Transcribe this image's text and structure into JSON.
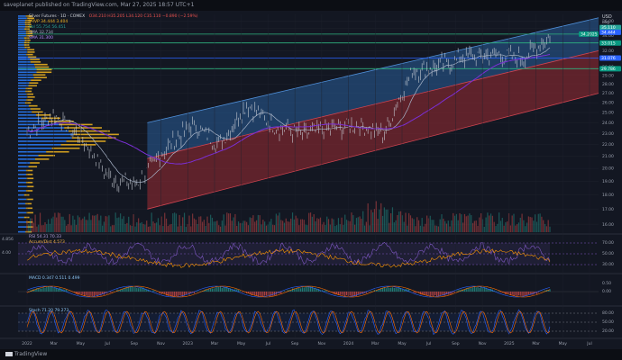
{
  "header": {
    "publish_note": "saveplanet published on TradingView.com, Mar 27, 2025 18:57 UTC+1"
  },
  "legend": {
    "symbol": "Silver Futures · 1D · COMEX",
    "ohlc": "O34.210 H35.205 L34.120 C35.110 −0.890 (−2.59%)",
    "vrvp": "VRVP 34.444  3.404",
    "vol": "Vol 55.754  56.451",
    "sma1": "SMA 32.734",
    "sma2": "SMA 31.300"
  },
  "panes": {
    "rsi_label": "RSI 54.31  70.33",
    "accdist_label": "Accum/Dist 4.573",
    "macd_label": "MACD 0.347 0.511 0.499",
    "stoch_label": "Stoch 71.20 79.273"
  },
  "price_axis": {
    "unit": "USD",
    "mode": "Log",
    "ticks": [
      "36.00",
      "35.00",
      "34.00",
      "33.00",
      "32.00",
      "31.00",
      "30.00",
      "29.00",
      "28.00",
      "27.00",
      "26.00",
      "25.00",
      "24.00",
      "23.00",
      "22.00",
      "21.00",
      "20.00",
      "19.00",
      "18.00",
      "17.00",
      "16.00"
    ],
    "badges": [
      {
        "text": "35.110",
        "color": "#26a69a"
      },
      {
        "text": "34.444",
        "color": "#2962ff"
      },
      {
        "text": "33.015",
        "color": "#089981"
      },
      {
        "text": "31.076",
        "color": "#2962ff"
      },
      {
        "text": "29.786",
        "color": "#089981"
      }
    ],
    "badge_left": {
      "text": "34.2025",
      "color": "#089981"
    }
  },
  "time_axis": {
    "labels": [
      "2022",
      "Mar",
      "May",
      "Jul",
      "Sep",
      "Nov",
      "2023",
      "Mar",
      "May",
      "Jul",
      "Sep",
      "Nov",
      "2024",
      "Mar",
      "May",
      "Jul",
      "Sep",
      "Nov",
      "2025",
      "Mar",
      "May",
      "Jul"
    ]
  },
  "left_values": {
    "rsi_top": "4.856",
    "rsi_mid": "4.00"
  },
  "osc_ticks": {
    "rsi": [
      "70.00",
      "50.00",
      "30.00"
    ],
    "macd": [
      "0.50",
      "0.00"
    ],
    "stoch": [
      "80.00",
      "50.00",
      "20.00"
    ]
  },
  "colors": {
    "background": "#131722",
    "candle": "#c7cbd4",
    "channel_upper": "#2f6fb6",
    "channel_lower": "#9c2b33",
    "sma_short": "#a8b4c8",
    "sma_long": "#7b2fd6",
    "vrvp_up": "#f2b620",
    "vrvp_down": "#2a7fff",
    "hline": "#2fb380",
    "hline_blue": "#2962ff",
    "rsi": "#7e57c2",
    "accdist": "#ff9800",
    "macd": "#2962ff",
    "signal": "#ff6d00",
    "stoch_k": "#2962ff",
    "stoch_d": "#ff6d00"
  },
  "chart_data": {
    "type": "line",
    "x": [
      "2022",
      "2022-Mar",
      "2022-May",
      "2022-Jul",
      "2022-Sep",
      "2022-Nov",
      "2023",
      "2023-Mar",
      "2023-May",
      "2023-Jul",
      "2023-Sep",
      "2023-Nov",
      "2024",
      "2024-Mar",
      "2024-May",
      "2024-Jul",
      "2024-Sep",
      "2024-Nov",
      "2025",
      "2025-Mar"
    ],
    "series": [
      {
        "values": [
          23.2,
          24.8,
          22.5,
          19.2,
          18.8,
          21.5,
          23.8,
          22.0,
          25.8,
          23.6,
          23.0,
          23.4,
          23.8,
          23.0,
          29.5,
          30.2,
          31.3,
          31.5,
          31.0,
          33.8
        ]
      }
    ],
    "channel": {
      "upper_start": 24.0,
      "upper_end": 36.5,
      "mid_start": 20.8,
      "mid_end": 32.0,
      "lower_start": 17.0,
      "lower_end": 27.0
    },
    "ylim": [
      15.5,
      37.0
    ],
    "horizontal_levels": [
      34.2025,
      33.015,
      31.076,
      29.786
    ]
  }
}
